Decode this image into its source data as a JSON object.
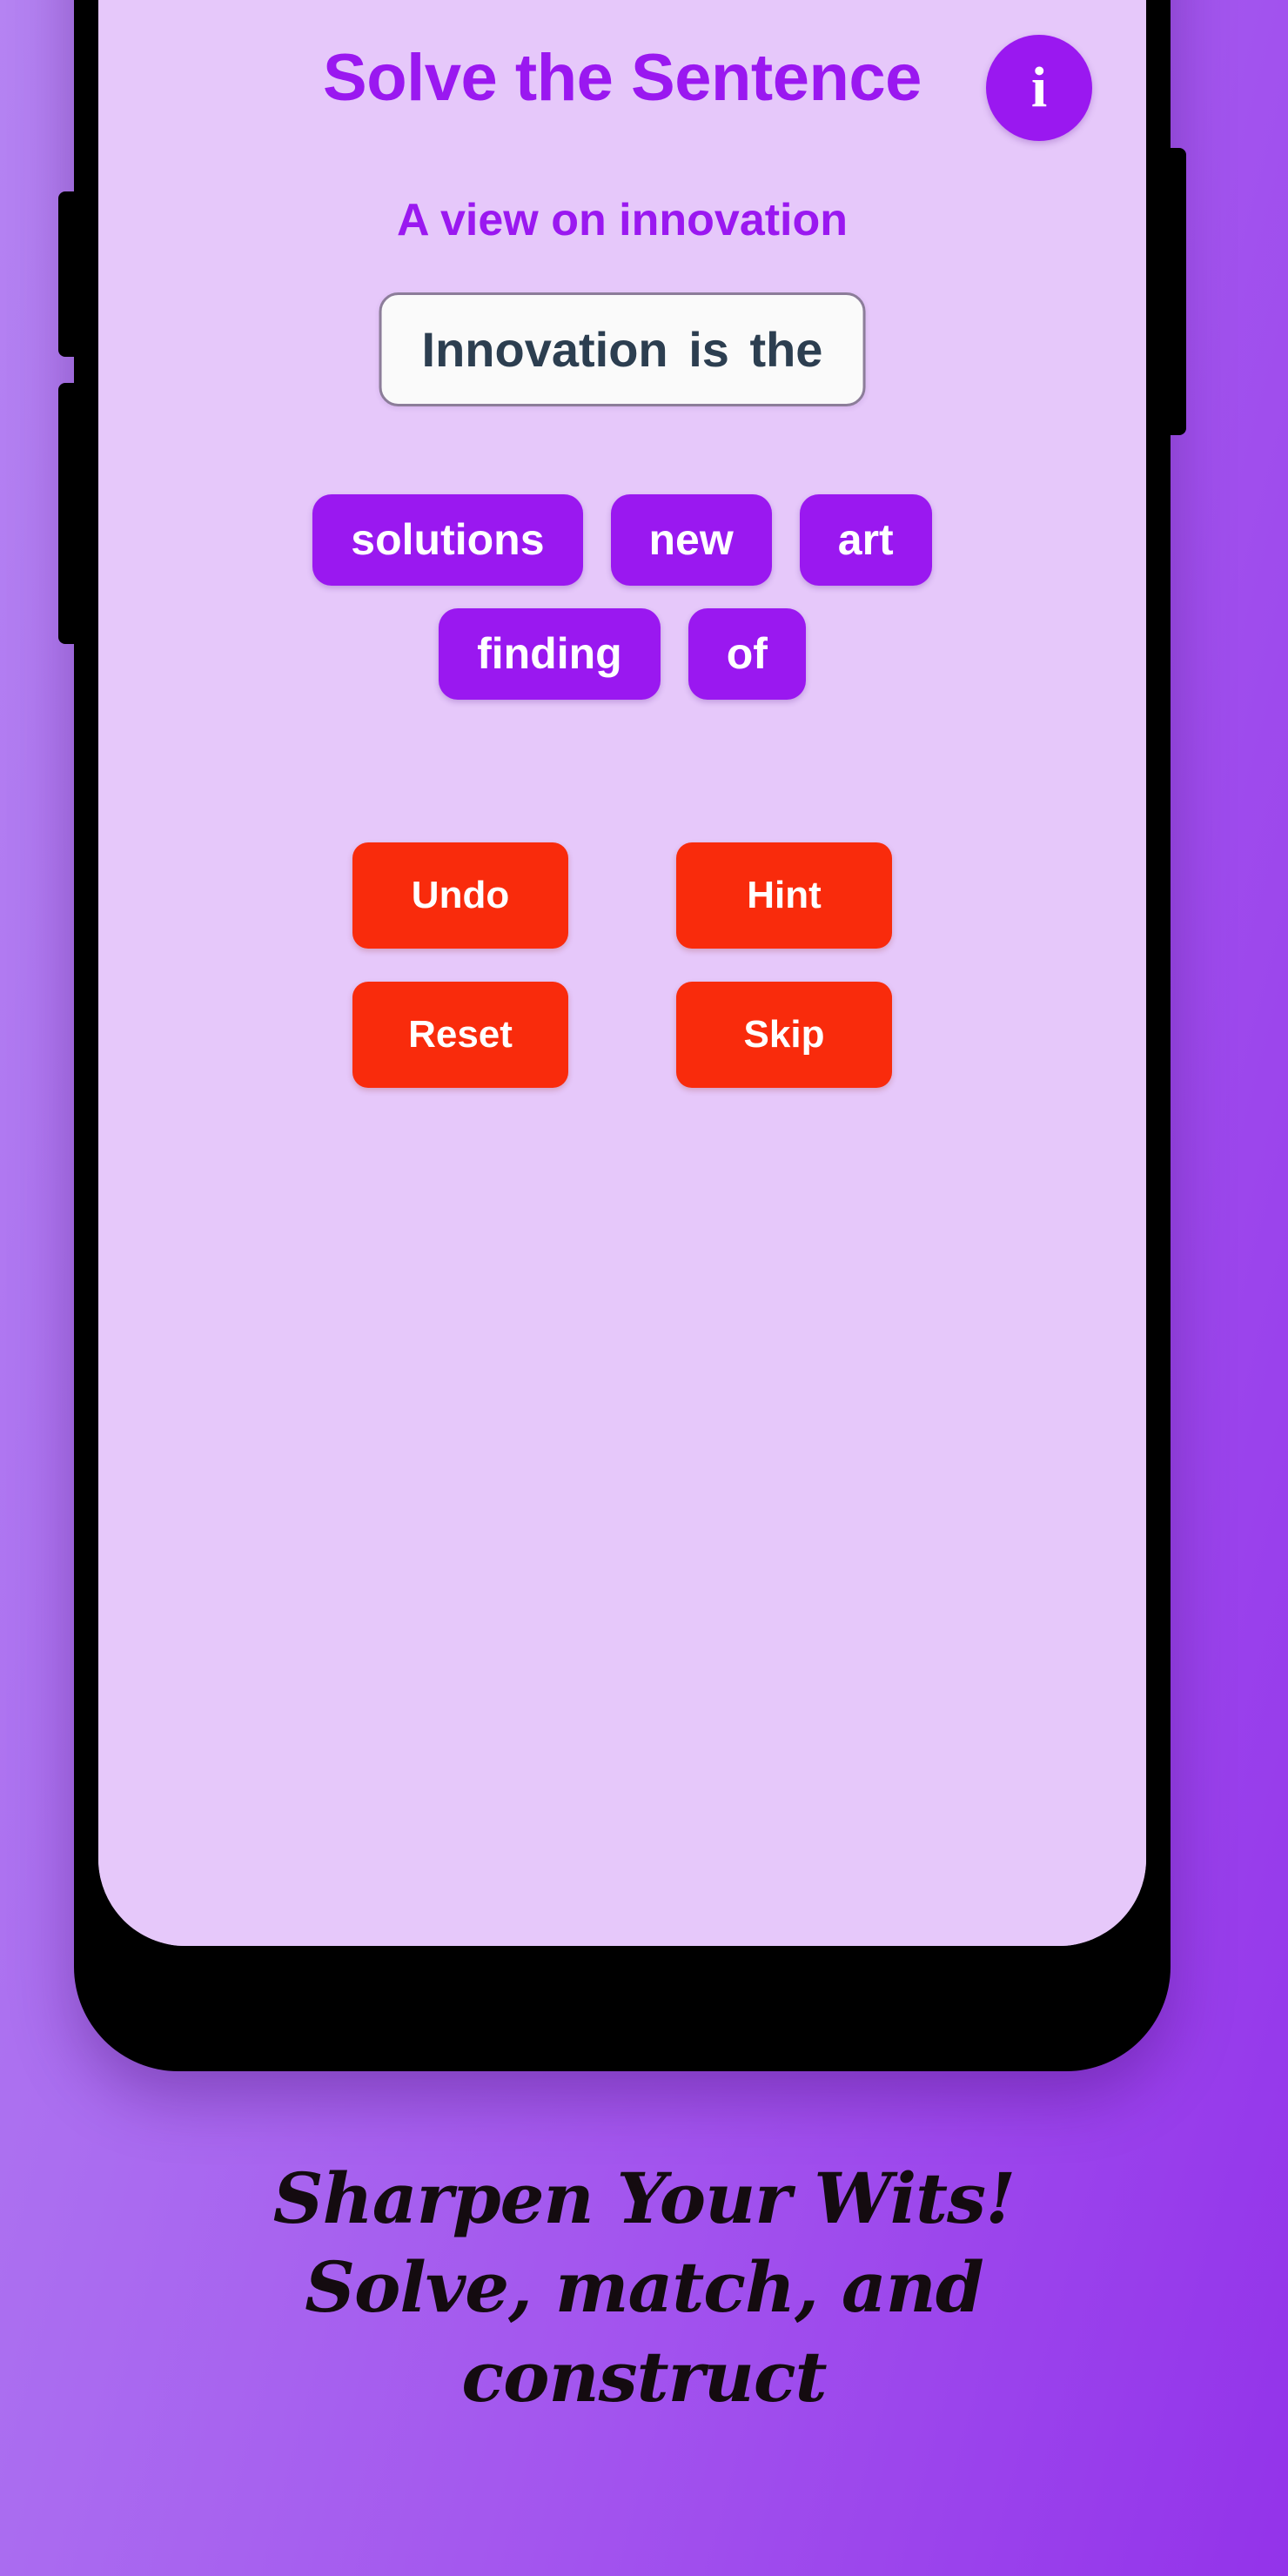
{
  "app": {
    "title": "Solve the Sentence",
    "puzzle_hint_title": "A view on innovation",
    "info_icon_glyph": "i"
  },
  "sentence": {
    "current_text": "Innovation is the"
  },
  "word_bank": {
    "rows": [
      {
        "words": [
          "solutions",
          "new",
          "art"
        ]
      },
      {
        "words": [
          "finding",
          "of"
        ]
      }
    ]
  },
  "actions": {
    "rows": [
      {
        "buttons": [
          "Undo",
          "Hint"
        ]
      },
      {
        "buttons": [
          "Reset",
          "Skip"
        ]
      }
    ]
  },
  "tagline": {
    "lines": [
      "Sharpen Your Wits!",
      "Solve, match, and",
      "construct"
    ]
  },
  "colors": {
    "brand_purple": "#9A18F0",
    "screen_background": "#E6C8FA",
    "action_red": "#F92B0C",
    "sentence_text": "#2C3E50",
    "page_gradient_start": "#B583F2",
    "page_gradient_end": "#9333EA"
  }
}
